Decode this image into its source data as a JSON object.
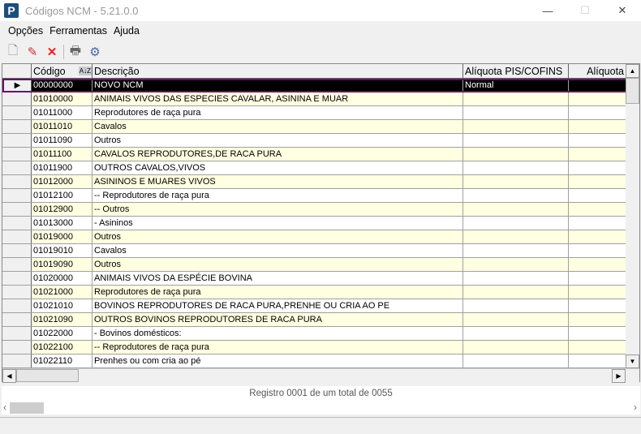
{
  "window": {
    "title": "Códigos NCM - 5.21.0.0",
    "minimize": "—",
    "maximize": "☐",
    "close": "✕"
  },
  "menu": [
    "Opções",
    "Ferramentas",
    "Ajuda"
  ],
  "grid": {
    "columns": [
      "Código",
      "Descrição",
      "Alíquota PIS/COFINS",
      "Alíquota"
    ],
    "sort_icon": "A↓Z",
    "rows": [
      [
        "00000000",
        "NOVO NCM",
        "Normal",
        ""
      ],
      [
        "01010000",
        "ANIMAIS VIVOS DAS ESPECIES CAVALAR, ASININA E MUAR",
        "",
        ""
      ],
      [
        "01011000",
        "Reprodutores de raça pura",
        "",
        ""
      ],
      [
        "01011010",
        "Cavalos",
        "",
        ""
      ],
      [
        "01011090",
        "Outros",
        "",
        ""
      ],
      [
        "01011100",
        "CAVALOS REPRODUTORES,DE RACA PURA",
        "",
        ""
      ],
      [
        "01011900",
        "OUTROS CAVALOS,VIVOS",
        "",
        ""
      ],
      [
        "01012000",
        "ASININOS E MUARES VIVOS",
        "",
        ""
      ],
      [
        "01012100",
        "-- Reprodutores de raça pura",
        "",
        ""
      ],
      [
        "01012900",
        "-- Outros",
        "",
        ""
      ],
      [
        "01013000",
        "- Asininos",
        "",
        ""
      ],
      [
        "01019000",
        "Outros",
        "",
        ""
      ],
      [
        "01019010",
        "Cavalos",
        "",
        ""
      ],
      [
        "01019090",
        "Outros",
        "",
        ""
      ],
      [
        "01020000",
        "ANIMAIS VIVOS DA ESPÉCIE BOVINA",
        "",
        ""
      ],
      [
        "01021000",
        "Reprodutores de raça pura",
        "",
        ""
      ],
      [
        "01021010",
        "BOVINOS REPRODUTORES DE RACA PURA,PRENHE OU CRIA AO PE",
        "",
        ""
      ],
      [
        "01021090",
        "OUTROS BOVINOS REPRODUTORES DE RACA PURA",
        "",
        ""
      ],
      [
        "01022000",
        "- Bovinos domésticos:",
        "",
        ""
      ],
      [
        "01022100",
        "-- Reprodutores de raça pura",
        "",
        ""
      ],
      [
        "01022110",
        "Prenhes ou com cria ao pé",
        "",
        ""
      ]
    ]
  },
  "status": "Registro 0001 de um total de 0055"
}
